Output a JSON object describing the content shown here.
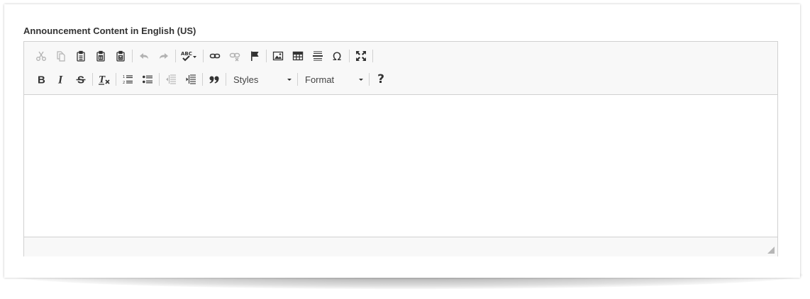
{
  "field": {
    "label": "Announcement Content in English (US)"
  },
  "toolbar": {
    "row1": [
      {
        "name": "cut-button",
        "icon": "scissors-icon",
        "disabled": true
      },
      {
        "name": "copy-button",
        "icon": "copy-icon",
        "disabled": true
      },
      {
        "name": "paste-button",
        "icon": "clipboard-icon",
        "disabled": false
      },
      {
        "name": "paste-text-button",
        "icon": "clipboard-text-icon",
        "disabled": false
      },
      {
        "name": "paste-word-button",
        "icon": "clipboard-word-icon",
        "disabled": false
      },
      {
        "name": "undo-button",
        "icon": "undo-icon",
        "disabled": true
      },
      {
        "name": "redo-button",
        "icon": "redo-icon",
        "disabled": true
      },
      {
        "name": "spellcheck-button",
        "icon": "spellcheck-icon",
        "disabled": false
      },
      {
        "name": "link-button",
        "icon": "link-icon",
        "disabled": false
      },
      {
        "name": "unlink-button",
        "icon": "unlink-icon",
        "disabled": true
      },
      {
        "name": "anchor-button",
        "icon": "flag-icon",
        "disabled": false
      },
      {
        "name": "image-button",
        "icon": "image-icon",
        "disabled": false
      },
      {
        "name": "table-button",
        "icon": "table-icon",
        "disabled": false
      },
      {
        "name": "horizontal-rule-button",
        "icon": "horizontal-rule-icon",
        "disabled": false
      },
      {
        "name": "special-char-button",
        "icon": "omega-icon",
        "disabled": false
      },
      {
        "name": "maximize-button",
        "icon": "maximize-icon",
        "disabled": false
      }
    ],
    "row2": [
      {
        "name": "bold-button",
        "icon": "bold-icon"
      },
      {
        "name": "italic-button",
        "icon": "italic-icon"
      },
      {
        "name": "strikethrough-button",
        "icon": "strikethrough-icon"
      },
      {
        "name": "remove-format-button",
        "icon": "clear-format-icon"
      },
      {
        "name": "numbered-list-button",
        "icon": "numbered-list-icon"
      },
      {
        "name": "bulleted-list-button",
        "icon": "bulleted-list-icon"
      },
      {
        "name": "outdent-button",
        "icon": "outdent-icon"
      },
      {
        "name": "indent-button",
        "icon": "indent-icon"
      },
      {
        "name": "blockquote-button",
        "icon": "quote-icon"
      },
      {
        "name": "help-button",
        "icon": "help-icon"
      }
    ],
    "styles_label": "Styles",
    "format_label": "Format",
    "help_label": "?"
  },
  "colors": {
    "toolbar_bg": "#f8f8f8",
    "border": "#d1d1d1",
    "icon": "#333333",
    "label": "#333333"
  }
}
